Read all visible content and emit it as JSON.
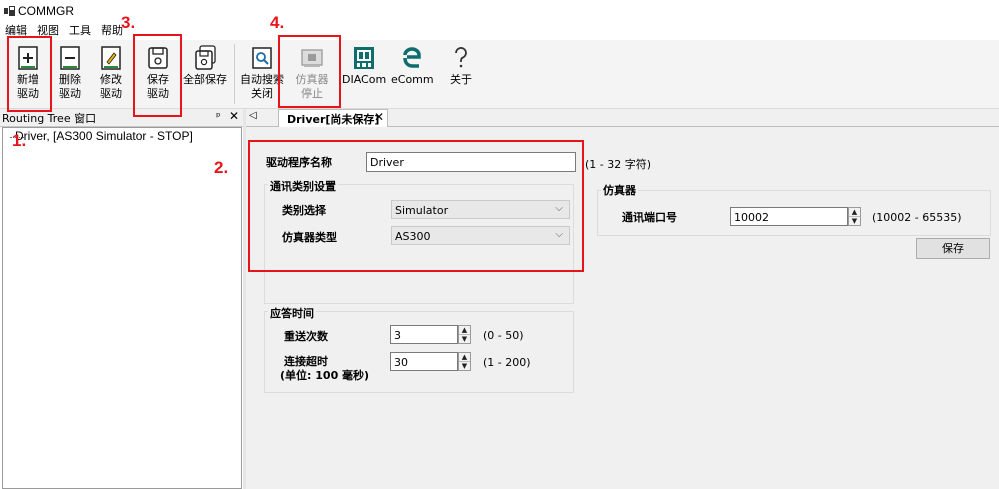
{
  "window": {
    "title": "COMMGR",
    "icon": "app-icon"
  },
  "menu": {
    "items": [
      "编辑",
      "视图",
      "工具",
      "帮助"
    ]
  },
  "toolbar": {
    "buttons": [
      {
        "label1": "新增",
        "label2": "驱动",
        "icon": "new-driver-icon"
      },
      {
        "label1": "删除",
        "label2": "驱动",
        "icon": "delete-driver-icon"
      },
      {
        "label1": "修改",
        "label2": "驱动",
        "icon": "edit-driver-icon"
      },
      {
        "label1": "保存",
        "label2": "驱动",
        "icon": "save-driver-icon"
      },
      {
        "label1": "全部保存",
        "label2": "",
        "icon": "save-all-icon"
      },
      {
        "label1": "自动搜索",
        "label2": "关闭",
        "icon": "auto-search-icon"
      },
      {
        "label1": "仿真器",
        "label2": "停止",
        "icon": "simulator-icon"
      },
      {
        "label1": "DIACom",
        "label2": "",
        "icon": "diacom-icon"
      },
      {
        "label1": "eComm",
        "label2": "",
        "icon": "ecomm-icon"
      },
      {
        "label1": "关于",
        "label2": "",
        "icon": "about-icon"
      }
    ]
  },
  "left_panel": {
    "title": "Routing Tree 窗口",
    "pin": "ᵖ",
    "close": "✕",
    "tree_items": [
      "Driver,  [AS300 Simulator - STOP]"
    ]
  },
  "tab": {
    "scroll": "◁",
    "label": "Driver[尚未保存]",
    "close": "✕"
  },
  "form": {
    "driver_name_label": "驱动程序名称",
    "driver_name_value": "Driver",
    "driver_name_range": "(1 - 32 字符)",
    "comm_group_title": "通讯类别设置",
    "category_label": "类别选择",
    "category_value": "Simulator",
    "sim_type_label": "仿真器类型",
    "sim_type_value": "AS300",
    "chevron": "⌵",
    "response_group_title": "应答时间",
    "retry_label": "重送次数",
    "retry_value": "3",
    "retry_range": "(0 - 50)",
    "timeout_label1": "连接超时",
    "timeout_label2": "(单位: 100 毫秒)",
    "timeout_value": "30",
    "timeout_range": "(1 - 200)",
    "simulator_group_title": "仿真器",
    "port_label": "通讯端口号",
    "port_value": "10002",
    "port_range": "(10002 - 65535)",
    "save_label": "保存",
    "spin_up": "▲",
    "spin_down": "▼"
  },
  "annotations": [
    "1.",
    "2.",
    "3.",
    "4."
  ],
  "colors": {
    "annotation_red": "#e8141c",
    "toolbar_bg": "#f4f4f4",
    "panel_bg": "#f0f0f0"
  }
}
